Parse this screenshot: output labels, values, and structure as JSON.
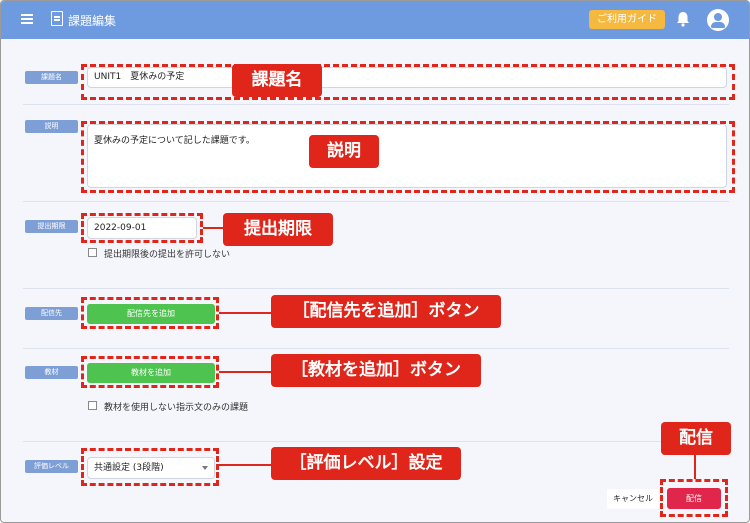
{
  "header": {
    "title": "課題編集",
    "guide_label": "ご利用ガイド"
  },
  "fields": {
    "title_label": "課題名",
    "title_value": "UNIT1　夏休みの予定",
    "description_label": "説明",
    "description_value": "夏休みの予定について記した課題です。",
    "deadline_label": "提出期限",
    "deadline_value": "2022-09-01",
    "late_submission_label": "提出期限後の提出を許可しない",
    "destination_label": "配信先",
    "add_destination_label": "配信先を追加",
    "material_label": "教材",
    "add_material_label": "教材を追加",
    "no_material_label": "教材を使用しない指示文のみの課題",
    "grading_label": "評価レベル",
    "grading_value": "共通設定 (3段階)"
  },
  "actions": {
    "cancel_label": "キャンセル",
    "publish_label": "配信"
  },
  "callouts": {
    "title": "課題名",
    "description": "説明",
    "deadline": "提出期限",
    "add_destination": "［配信先を追加］ボタン",
    "add_material": "［教材を追加］ボタン",
    "grading": "［評価レベル］設定",
    "publish": "配信"
  },
  "icons": {
    "menu": "hamburger-icon",
    "document": "document-icon",
    "bell": "bell-icon",
    "avatar": "account-icon",
    "dropdown": "chevron-down-icon"
  },
  "colors": {
    "appbar": "#6e9be0",
    "label_chip": "#7e9fd6",
    "annotation": "#e0261a",
    "green_button": "#4fc34f",
    "publish_button": "#e0264a",
    "guide_button": "#f5b940"
  }
}
